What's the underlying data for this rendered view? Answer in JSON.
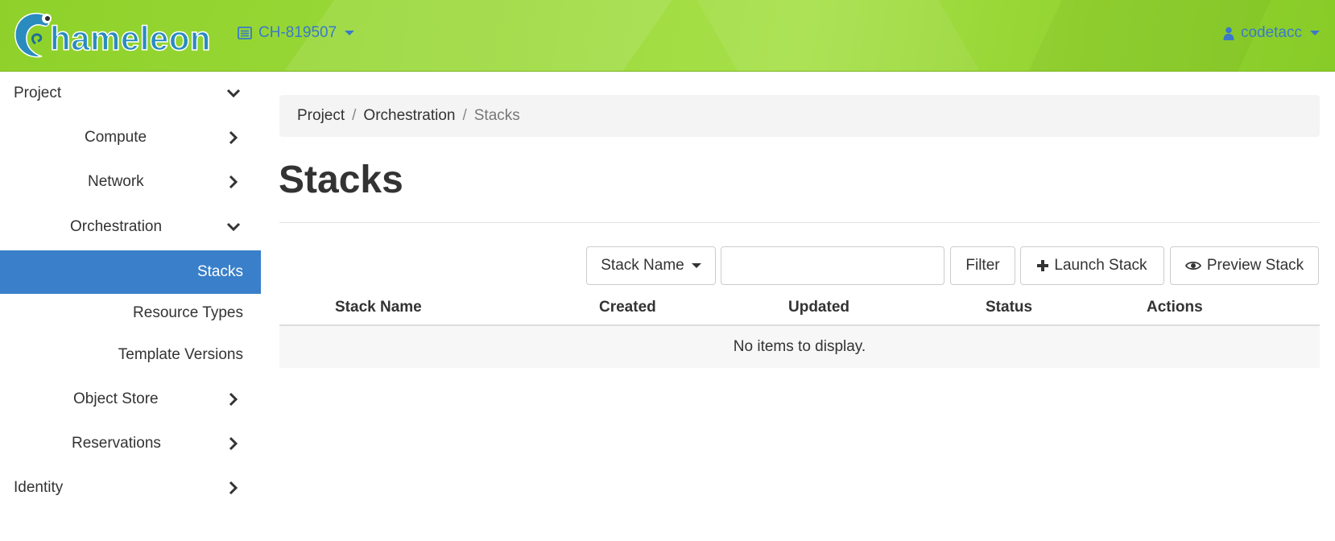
{
  "header": {
    "logo_text": "hameleon",
    "project": "CH-819507",
    "user": "codetacc",
    "colors": {
      "accent": "#3a79c9",
      "header_green": "#9ad93a"
    }
  },
  "sidebar": {
    "items": [
      {
        "label": "Project",
        "chevron": "chevron-down-icon"
      },
      {
        "label": "Compute",
        "chevron": "chevron-right-icon"
      },
      {
        "label": "Network",
        "chevron": "chevron-right-icon"
      },
      {
        "label": "Orchestration",
        "chevron": "chevron-down-icon"
      },
      {
        "label": "Stacks",
        "active": true
      },
      {
        "label": "Resource Types"
      },
      {
        "label": "Template Versions"
      },
      {
        "label": "Object Store",
        "chevron": "chevron-right-icon"
      },
      {
        "label": "Reservations",
        "chevron": "chevron-right-icon"
      },
      {
        "label": "Identity",
        "chevron": "chevron-right-icon"
      }
    ],
    "active_color": "#3a7fc9"
  },
  "breadcrumb": {
    "items": [
      "Project",
      "Orchestration"
    ],
    "current": "Stacks"
  },
  "page": {
    "title": "Stacks"
  },
  "toolbar": {
    "filter_field_label": "Stack Name",
    "filter_value": "",
    "filter_button": "Filter",
    "launch_button": "Launch Stack",
    "preview_button": "Preview Stack"
  },
  "table": {
    "columns": [
      "Stack Name",
      "Created",
      "Updated",
      "Status",
      "Actions"
    ],
    "empty_message": "No items to display."
  }
}
